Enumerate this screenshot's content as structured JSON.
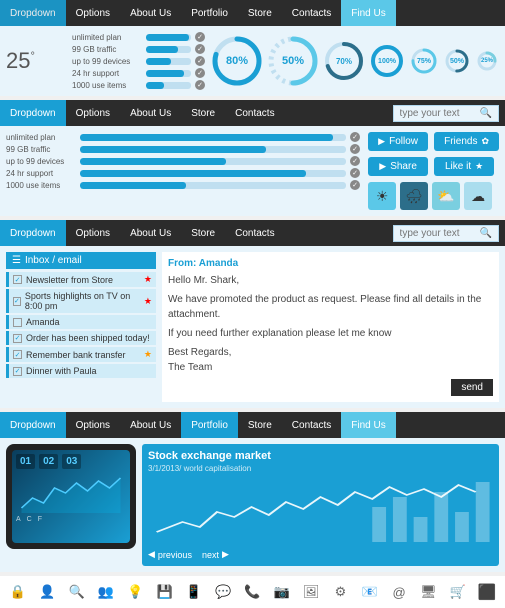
{
  "nav1": {
    "items": [
      {
        "label": "Dropdown",
        "state": "active"
      },
      {
        "label": "Options",
        "state": "normal"
      },
      {
        "label": "About Us",
        "state": "normal"
      },
      {
        "label": "Portfolio",
        "state": "normal"
      },
      {
        "label": "Store",
        "state": "normal"
      },
      {
        "label": "Contacts",
        "state": "normal"
      },
      {
        "label": "Find Us",
        "state": "light"
      }
    ]
  },
  "weather": {
    "temp": "25",
    "unit": "°"
  },
  "stats": [
    {
      "label": "unlimited plan",
      "pct": 95
    },
    {
      "label": "99 GB traffic",
      "pct": 70
    },
    {
      "label": "up to 99 devices",
      "pct": 55
    },
    {
      "label": "24 hr support",
      "pct": 85
    },
    {
      "label": "1000 use items",
      "pct": 40
    }
  ],
  "gauges": [
    {
      "value": 80,
      "color": "#1a9fd4",
      "size": 52,
      "label": "80%"
    },
    {
      "value": 50,
      "color": "#5bc8e8",
      "size": 52,
      "label": "50%"
    },
    {
      "value": 70,
      "color": "#2c6e8a",
      "size": 42,
      "label": "70%"
    },
    {
      "value": 100,
      "color": "#1a9fd4",
      "size": 36,
      "label": "100%"
    },
    {
      "value": 75,
      "color": "#5bc8e8",
      "size": 30,
      "label": "75%"
    },
    {
      "value": 50,
      "color": "#2c6e8a",
      "size": 28,
      "label": "50%"
    },
    {
      "value": 25,
      "color": "#7acfe0",
      "size": 24,
      "label": "25%"
    }
  ],
  "nav2": {
    "items": [
      {
        "label": "Dropdown",
        "state": "active"
      },
      {
        "label": "Options",
        "state": "normal"
      },
      {
        "label": "About Us",
        "state": "normal"
      },
      {
        "label": "Store",
        "state": "normal"
      },
      {
        "label": "Contacts",
        "state": "normal"
      }
    ],
    "search_placeholder": "type your text"
  },
  "buttons": {
    "follow": "Follow",
    "friends": "Friends",
    "share": "Share",
    "likeit": "Like it"
  },
  "weather_icons": [
    "☀",
    "🌧",
    "⛅",
    "☁"
  ],
  "nav3": {
    "items": [
      {
        "label": "Dropdown",
        "state": "active"
      },
      {
        "label": "Options",
        "state": "normal"
      },
      {
        "label": "About Us",
        "state": "normal"
      },
      {
        "label": "Store",
        "state": "normal"
      },
      {
        "label": "Contacts",
        "state": "normal"
      }
    ],
    "search_placeholder": "type your text"
  },
  "inbox": {
    "title": "Inbox / email",
    "items": [
      {
        "text": "Newsletter from Store",
        "checked": true,
        "starred": true,
        "star_color": "red"
      },
      {
        "text": "Sports highlights on TV on 8:00 pm",
        "checked": true,
        "starred": true,
        "star_color": "red"
      },
      {
        "text": "Amanda",
        "checked": false,
        "starred": false
      },
      {
        "text": "Order has been shipped today!",
        "checked": true,
        "starred": false
      },
      {
        "text": "Remember bank transfer",
        "checked": true,
        "starred": true,
        "star_color": "gold"
      },
      {
        "text": "Dinner with Paula",
        "checked": true,
        "starred": false
      }
    ]
  },
  "email": {
    "from_label": "From:",
    "from_name": "Amanda",
    "greeting": "Hello Mr. Shark,",
    "body1": "We have promoted the product as request. Please find all details in the attachment.",
    "body2": "If you need further explanation please let me know",
    "regards": "Best Regards,",
    "team": "The Team",
    "send_label": "send"
  },
  "nav4": {
    "items": [
      {
        "label": "Dropdown",
        "state": "active"
      },
      {
        "label": "Options",
        "state": "normal"
      },
      {
        "label": "About Us",
        "state": "normal"
      },
      {
        "label": "Portfolio",
        "state": "highlight"
      },
      {
        "label": "Store",
        "state": "normal"
      },
      {
        "label": "Contacts",
        "state": "normal"
      },
      {
        "label": "Find Us",
        "state": "normal"
      }
    ]
  },
  "timer": {
    "h": "01",
    "m": "02",
    "s": "03"
  },
  "chart_labels": [
    "A",
    "C",
    "F"
  ],
  "stock": {
    "title": "Stock exchange market",
    "subtitle": "3/1/2013/ world capitalisation",
    "prev": "previous",
    "next": "next"
  },
  "icons": [
    "🔒",
    "👤",
    "🔍",
    "💡",
    "💾",
    "📱",
    "💬",
    "📞",
    "📷",
    "💻",
    "🔧",
    "📧",
    "🛒",
    "📊"
  ]
}
